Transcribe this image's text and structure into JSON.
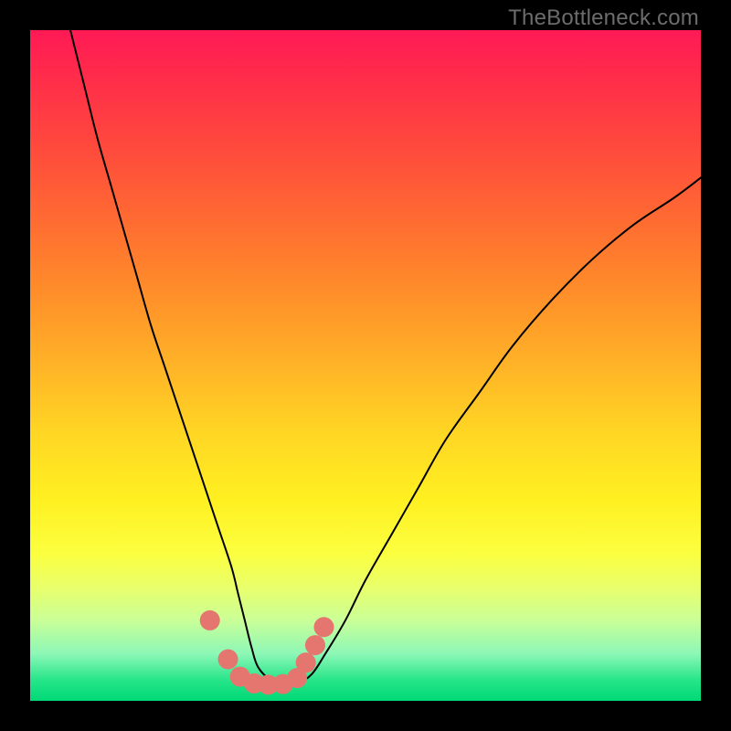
{
  "watermark": "TheBottleneck.com",
  "chart_data": {
    "type": "line",
    "title": "",
    "xlabel": "",
    "ylabel": "",
    "xlim": [
      0,
      100
    ],
    "ylim": [
      0,
      100
    ],
    "grid": false,
    "series": [
      {
        "name": "curve",
        "color": "#000000",
        "x": [
          6,
          8,
          10,
          12,
          14,
          16,
          18,
          20,
          22,
          24,
          26,
          28,
          30,
          31,
          32,
          33,
          34,
          36,
          38,
          40,
          42,
          44,
          47,
          50,
          54,
          58,
          62,
          67,
          72,
          78,
          84,
          90,
          96,
          100
        ],
        "y": [
          100,
          92,
          84,
          77,
          70,
          63,
          56,
          50,
          44,
          38,
          32,
          26,
          20,
          16,
          12,
          8,
          5,
          3,
          2.4,
          2.7,
          4,
          7,
          12,
          18,
          25,
          32,
          39,
          46,
          53,
          60,
          66,
          71,
          75,
          78
        ]
      }
    ],
    "markers": {
      "name": "highlight-dots",
      "color": "#e5766f",
      "radius_pct": 1.5,
      "points": [
        {
          "x": 26.8,
          "y": 12.0
        },
        {
          "x": 29.5,
          "y": 6.2
        },
        {
          "x": 31.3,
          "y": 3.6
        },
        {
          "x": 33.4,
          "y": 2.6
        },
        {
          "x": 35.5,
          "y": 2.4
        },
        {
          "x": 37.7,
          "y": 2.5
        },
        {
          "x": 39.8,
          "y": 3.4
        },
        {
          "x": 41.1,
          "y": 5.7
        },
        {
          "x": 42.5,
          "y": 8.3
        },
        {
          "x": 43.8,
          "y": 11.0
        }
      ]
    }
  }
}
